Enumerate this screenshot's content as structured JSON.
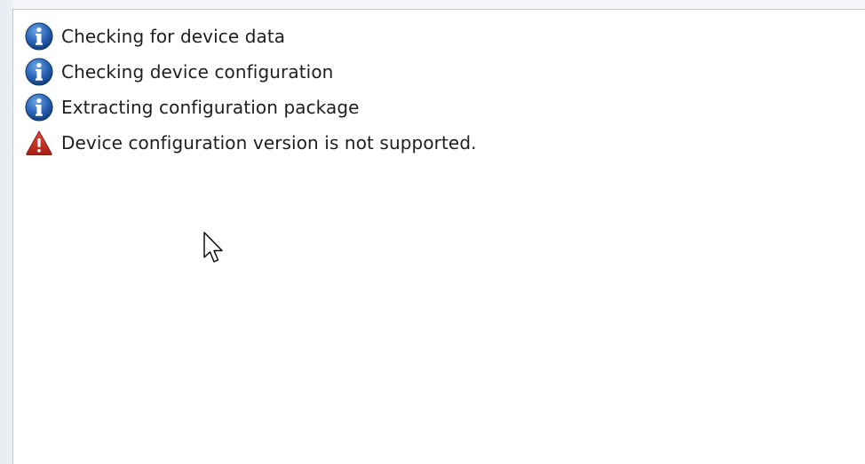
{
  "log": {
    "entries": [
      {
        "icon": "info-icon",
        "text": "Checking for device data"
      },
      {
        "icon": "info-icon",
        "text": "Checking device configuration"
      },
      {
        "icon": "info-icon",
        "text": "Extracting configuration package"
      },
      {
        "icon": "warning-icon",
        "text": "Device configuration version is not supported."
      }
    ]
  },
  "colors": {
    "info_blue": "#1f5fb3",
    "warning_red": "#c62828",
    "text": "#1e1e1e"
  }
}
